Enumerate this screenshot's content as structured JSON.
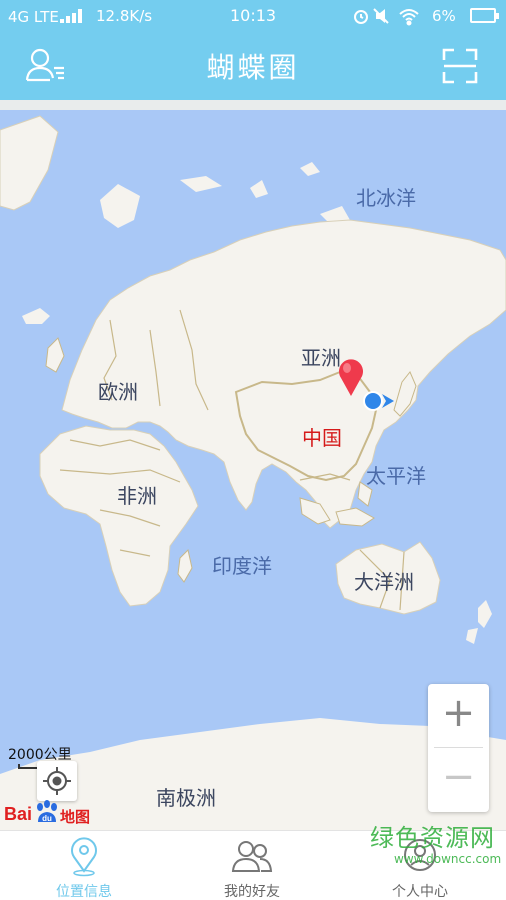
{
  "status_bar": {
    "network": "4G LTE",
    "speed": "12.8K/s",
    "time": "10:13",
    "battery": "6%"
  },
  "header": {
    "title": "蝴蝶圈"
  },
  "map": {
    "labels": {
      "arctic_ocean": "北冰洋",
      "asia": "亚洲",
      "europe": "欧洲",
      "china": "中国",
      "africa": "非洲",
      "pacific": "太平洋",
      "indian_ocean": "印度洋",
      "oceania": "大洋洲",
      "antarctica": "南极洲"
    },
    "scale": "2000公里",
    "zoom_in": "+",
    "zoom_out": "−",
    "baidu_text": "Bai",
    "baidu_du": "du",
    "baidu_ditu": "地图",
    "colors": {
      "water": "#a9c8f6",
      "land": "#f5f3ee",
      "border": "#c8b88a",
      "pin": "#ef3a4c",
      "location": "#2f86e9"
    }
  },
  "tabs": [
    {
      "label": "位置信息",
      "icon": "location-pin-icon",
      "active": true
    },
    {
      "label": "我的好友",
      "icon": "friends-icon",
      "active": false
    },
    {
      "label": "个人中心",
      "icon": "profile-icon",
      "active": false
    }
  ],
  "watermark": {
    "text": "绿色资源网",
    "url": "www.downcc.com"
  },
  "theme": {
    "primary": "#74cdef",
    "active_tab": "#6fc8eb"
  }
}
